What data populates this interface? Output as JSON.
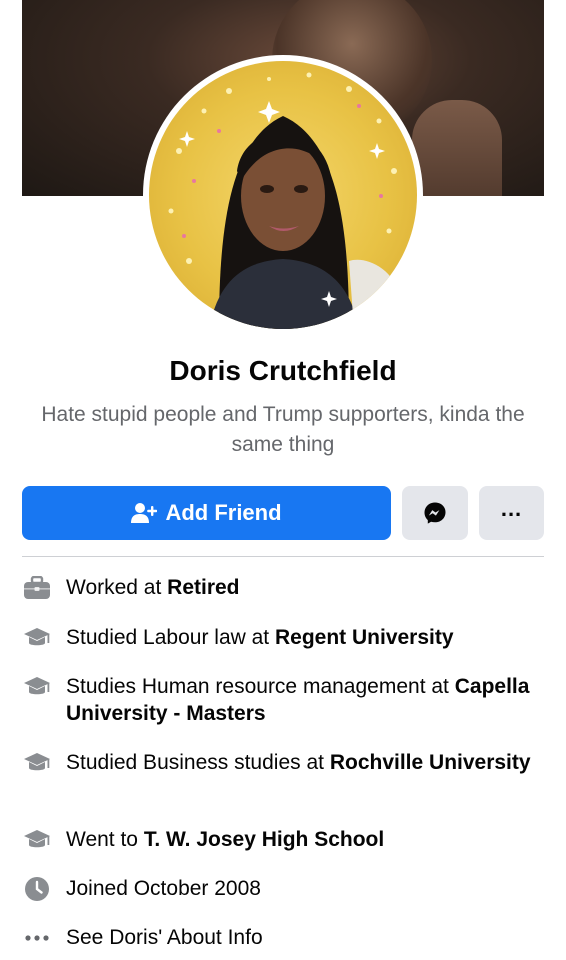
{
  "profile": {
    "name": "Doris Crutchfield",
    "bio": "Hate stupid people and Trump supporters, kinda the same thing"
  },
  "actions": {
    "add_friend_label": "Add Friend",
    "more_label": "..."
  },
  "intro": {
    "work": {
      "prefix": "Worked at ",
      "bold": "Retired"
    },
    "edu1": {
      "prefix": "Studied Labour law at ",
      "bold": "Regent University"
    },
    "edu2": {
      "prefix": "Studies Human resource management at ",
      "bold": "Capella University - Masters"
    },
    "edu3": {
      "prefix": "Studied Business studies at ",
      "bold": "Rochville University"
    },
    "school": {
      "prefix": "Went to ",
      "bold": "T. W. Josey High School"
    },
    "joined": "Joined October 2008",
    "see_about": "See Doris' About Info"
  },
  "icons": {
    "work": "briefcase-icon",
    "education": "graduation-cap-icon",
    "joined": "clock-icon",
    "see_about": "more-dots-icon",
    "add_friend": "add-person-icon",
    "messenger": "messenger-icon"
  },
  "colors": {
    "primary": "#1877f2",
    "secondary_button": "#e4e6eb",
    "muted_text": "#65676b",
    "icon_gray": "#8a8d91"
  }
}
